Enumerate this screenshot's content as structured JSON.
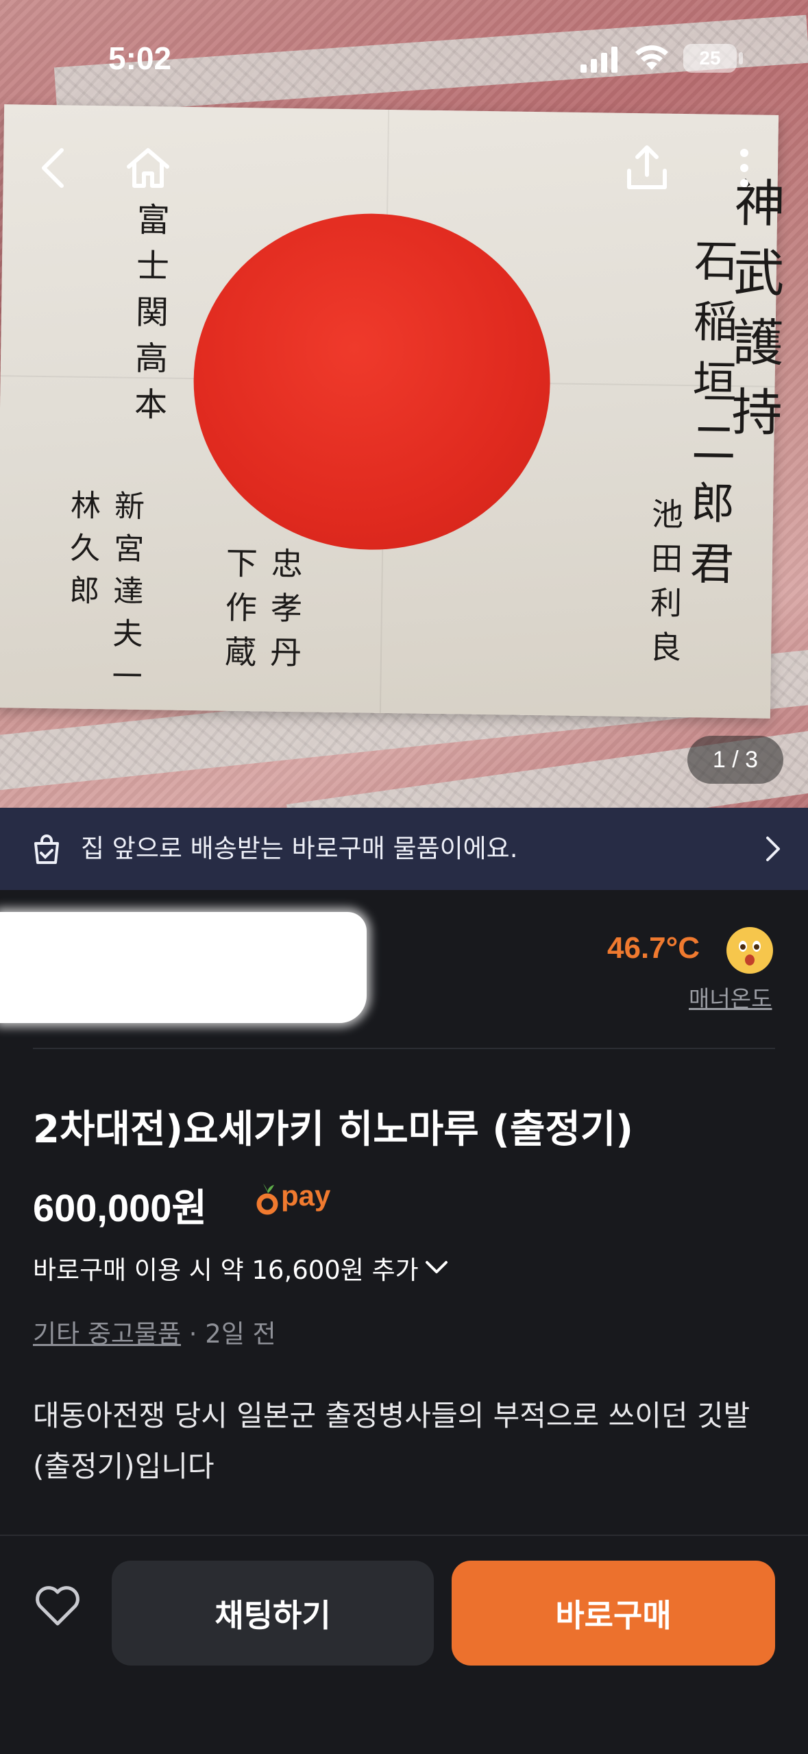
{
  "status_bar": {
    "time": "5:02",
    "battery": "25"
  },
  "photo": {
    "pager": "1 / 3",
    "inscriptions": {
      "right_large": "神 武 護 持",
      "right_mid": "石 稲 垣 二 郎 君",
      "right_small": "池 田 利 良",
      "left_mid": "富 士 関 高 本",
      "bottom_mid": "忠 孝 丹 下 作 蔵",
      "left_bottom": "新 宮 達 夫 一 林 久 郎"
    }
  },
  "banner": {
    "text": "집 앞으로 배송받는 바로구매 물품이에요."
  },
  "seller": {
    "manner_value": "46.7°C",
    "manner_label": "매너온도"
  },
  "listing": {
    "title": "2차대전)요세가키 히노마루 (출정기)",
    "price": "600,000원",
    "pay_label": "pay",
    "extra_fee": "바로구매 이용 시 약 16,600원 추가",
    "category": "기타 중고물품",
    "time_ago": "· 2일 전",
    "description": "대동아전쟁 당시 일본군 출정병사들의 부적으로 쓰이던 깃발(출정기)입니다"
  },
  "actions": {
    "chat": "채팅하기",
    "buy": "바로구매"
  },
  "colors": {
    "accent": "#ec712d",
    "banner_bg": "#272c45",
    "background": "#18191d"
  }
}
